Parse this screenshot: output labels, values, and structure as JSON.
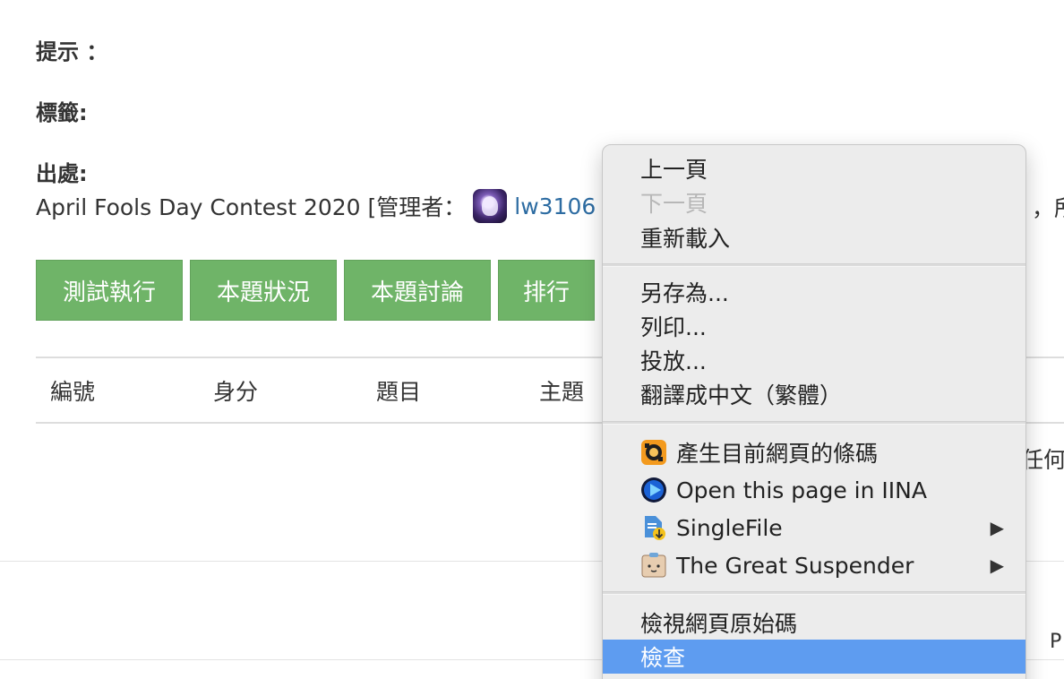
{
  "content": {
    "hint_label": "提示 ：",
    "tags_label": "標籤:",
    "source_label": "出處:",
    "source_text": "April Fools Day Contest 2020 [管理者：",
    "manager_name": "lw3106",
    "right_fragment_1": "，所",
    "right_fragment_2": "任何",
    "right_fragment_3": "P"
  },
  "buttons": [
    {
      "label": "測試執行"
    },
    {
      "label": "本題狀況"
    },
    {
      "label": "本題討論"
    },
    {
      "label": "排行"
    }
  ],
  "table": {
    "headers": [
      "編號",
      "身分",
      "題目",
      "主題"
    ]
  },
  "context_menu": {
    "items": [
      {
        "label": "上一頁"
      },
      {
        "label": "下一頁"
      },
      {
        "label": "重新載入"
      },
      {
        "label": "另存為..."
      },
      {
        "label": "列印..."
      },
      {
        "label": "投放..."
      },
      {
        "label": "翻譯成中文（繁體）"
      },
      {
        "label": "產生目前網頁的條碼",
        "icon": "qr-generator-icon"
      },
      {
        "label": "Open this page in IINA",
        "icon": "iina-icon"
      },
      {
        "label": "SingleFile",
        "icon": "singlefile-icon"
      },
      {
        "label": "The Great Suspender",
        "icon": "great-suspender-icon"
      },
      {
        "label": "檢視網頁原始碼"
      },
      {
        "label": "檢查"
      }
    ],
    "submenu_arrow": "▶",
    "highlight_color": "#5e9cf0"
  },
  "colors": {
    "button_green": "#6fb468",
    "link_blue": "#2d6ca2"
  }
}
